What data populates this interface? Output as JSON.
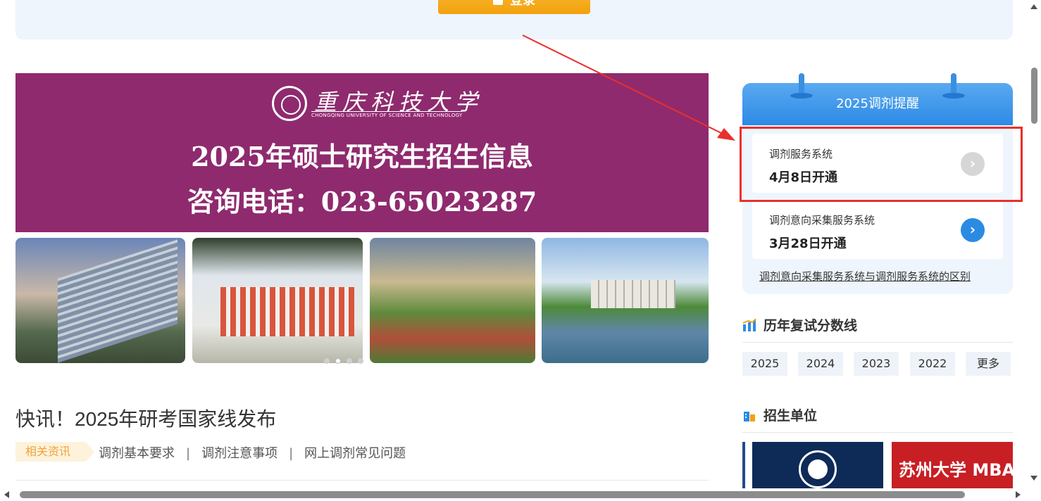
{
  "top": {
    "login_label": "登录"
  },
  "banner": {
    "university_cn": "重庆科技大学",
    "university_en": "CHONGQING UNIVERSITY OF SCIENCE AND TECHNOLOGY",
    "line1": "2025年硕士研究生招生信息",
    "line2": "咨询电话：023-65023287",
    "slide_count": 4,
    "active_slide": 1
  },
  "news": {
    "headline": "快讯！2025年研考国家线发布",
    "tag": "相关资讯",
    "links": [
      "调剂基本要求",
      "调剂注意事项",
      "网上调剂常见问题"
    ],
    "separator": "|"
  },
  "reminder": {
    "title": "2025调剂提醒",
    "cards": [
      {
        "title": "调剂服务系统",
        "date": "4月8日开通",
        "state": "inactive"
      },
      {
        "title": "调剂意向采集服务系统",
        "date": "3月28日开通",
        "state": "active"
      }
    ],
    "diff_link": "调剂意向采集服务系统与调剂服务系统的区别"
  },
  "scores": {
    "title": "历年复试分数线",
    "years": [
      "2025",
      "2024",
      "2023",
      "2022",
      "更多"
    ]
  },
  "units": {
    "title": "招生单位",
    "items": [
      "",
      "",
      "苏州大学 MBA"
    ]
  },
  "colors": {
    "banner": "#8f2a6e",
    "accent_blue": "#2b8be3",
    "login_orange": "#f2a10d",
    "highlight_red": "#e8302c"
  }
}
